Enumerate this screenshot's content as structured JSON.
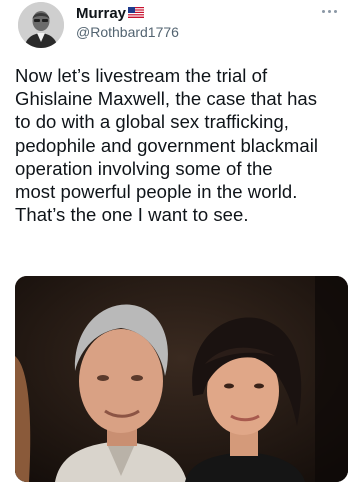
{
  "user": {
    "display_name": "Murray",
    "handle": "@Rothbard1776",
    "flag_icon": "us-flag-icon",
    "avatar_icon": "avatar-portrait"
  },
  "menu": {
    "icon": "more-horizontal-icon"
  },
  "tweet": {
    "lines": [
      "Now let’s livestream the trial of",
      "Ghislaine Maxwell, the case that has",
      "to do with a global sex trafficking,",
      "pedophile and government blackmail",
      "operation involving some of the",
      "most powerful people in the world.",
      "That’s the one I want to see."
    ]
  },
  "media": {
    "type": "photo",
    "subject": "two people posing together"
  },
  "colors": {
    "text": "#0f1419",
    "secondary": "#536471",
    "background": "#ffffff"
  }
}
